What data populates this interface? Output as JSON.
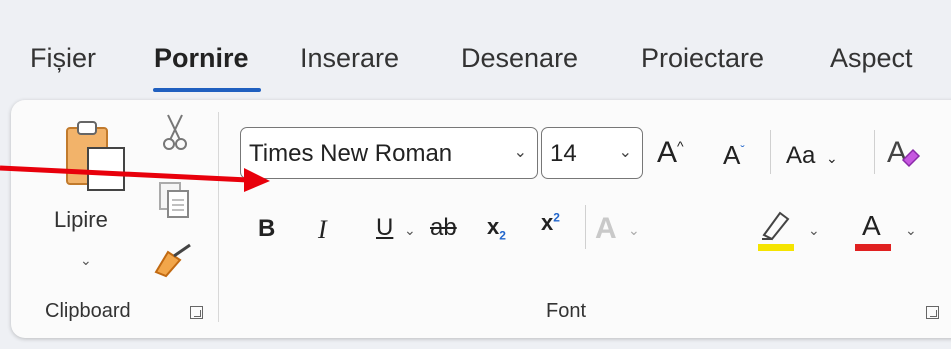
{
  "tabs": [
    "Fișier",
    "Pornire",
    "Inserare",
    "Desenare",
    "Proiectare",
    "Aspect"
  ],
  "active_tab": "Pornire",
  "clipboard": {
    "paste_label": "Lipire",
    "group_label": "Clipboard"
  },
  "font": {
    "family": "Times New Roman",
    "size": "14",
    "case_label": "Aa",
    "group_label": "Font",
    "highlight_color": "#f5e400",
    "font_color": "#e02020"
  },
  "icons": {
    "paste": "clipboard-paste-icon",
    "cut": "scissors-icon",
    "copy": "copy-icon",
    "format_painter": "paintbrush-icon"
  },
  "annotation": {
    "arrow_color": "#e8000b"
  }
}
